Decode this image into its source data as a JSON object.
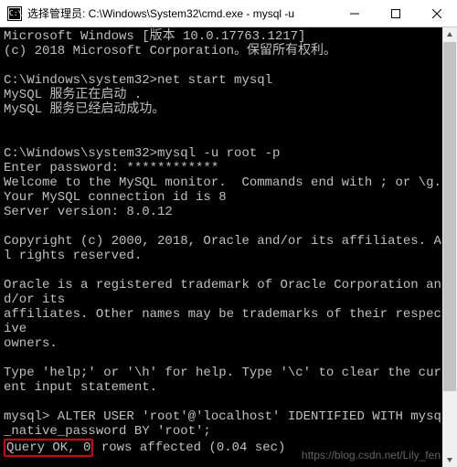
{
  "titlebar": {
    "title": "选择管理员: C:\\Windows\\System32\\cmd.exe - mysql  -u "
  },
  "terminal": {
    "lines": [
      "Microsoft Windows [版本 10.0.17763.1217]",
      "(c) 2018 Microsoft Corporation。保留所有权利。",
      "",
      "C:\\Windows\\system32>net start mysql",
      "MySQL 服务正在启动 .",
      "MySQL 服务已经启动成功。",
      "",
      "",
      "C:\\Windows\\system32>mysql -u root -p",
      "Enter password: ************",
      "Welcome to the MySQL monitor.  Commands end with ; or \\g.",
      "Your MySQL connection id is 8",
      "Server version: 8.0.12",
      "",
      "Copyright (c) 2000, 2018, Oracle and/or its affiliates. All rights reserved.",
      "",
      "Oracle is a registered trademark of Oracle Corporation and/or its",
      "affiliates. Other names may be trademarks of their respective",
      "owners.",
      "",
      "Type 'help;' or '\\h' for help. Type '\\c' to clear the current input statement.",
      "",
      "mysql> ALTER USER 'root'@'localhost' IDENTIFIED WITH mysql_native_password BY 'root';"
    ],
    "highlighted_prefix": "Query OK, 0",
    "highlighted_suffix": " rows affected (0.04 sec)"
  },
  "watermark": "https://blog.csdn.net/Lily_fen"
}
